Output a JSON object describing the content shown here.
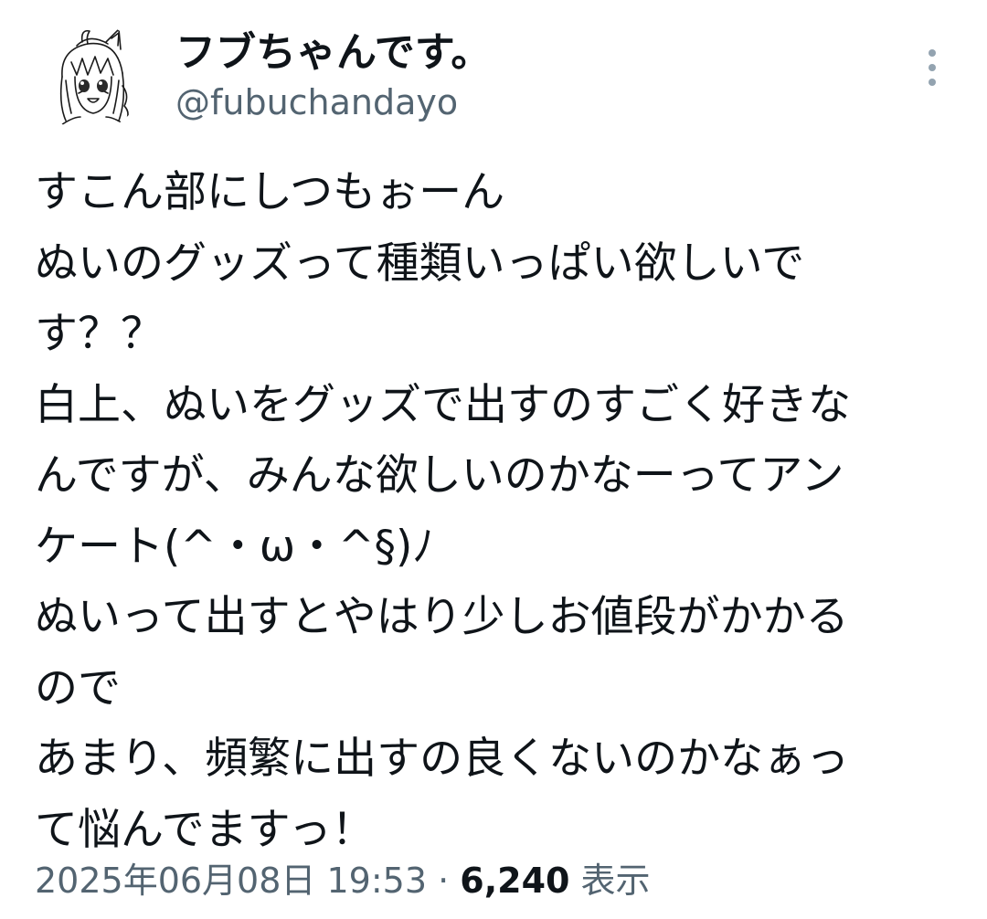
{
  "author": {
    "display_name": "フブちゃんです。",
    "handle": "@fubuchandayo",
    "avatar_icon": "anime-character-sketch-avatar"
  },
  "more_icon": "more-vertical-icon",
  "tweet": {
    "lines": [
      "すこん部にしつもぉーん",
      "ぬいのグッズって種類いっぱい欲しいで",
      "す？？",
      "白上、ぬいをグッズで出すのすごく好きな",
      "んですが、みんな欲しいのかなーってアン",
      "ケート(^・ω・^§)ﾉ",
      "ぬいって出すとやはり少しお値段がかかる",
      "ので",
      "あまり、頻繁に出すの良くないのかなぁっ",
      "て悩んでますっ！"
    ]
  },
  "meta": {
    "timestamp": "2025年06月08日 19:53",
    "separator": " · ",
    "views_count": "6,240",
    "views_label": " 表示"
  },
  "colors": {
    "text_primary": "#0f1419",
    "text_secondary": "#536471",
    "icon_muted": "#93a3b0",
    "background": "#ffffff"
  }
}
